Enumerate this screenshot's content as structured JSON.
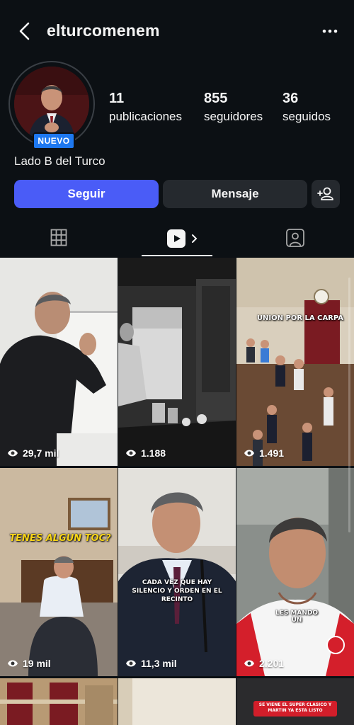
{
  "profile": {
    "username": "elturcomenem",
    "badge": "NUEVO",
    "display_name": "Lado B del Turco",
    "stats": {
      "posts": {
        "value": "11",
        "label": "publicaciones"
      },
      "followers": {
        "value": "855",
        "label": "seguidores"
      },
      "following": {
        "value": "36",
        "label": "seguidos"
      }
    }
  },
  "actions": {
    "follow_label": "Seguir",
    "message_label": "Mensaje"
  },
  "tabs": [
    {
      "name": "grid",
      "icon": "grid-icon"
    },
    {
      "name": "reels",
      "icon": "reels-icon",
      "active": true
    },
    {
      "name": "tagged",
      "icon": "tagged-icon"
    }
  ],
  "reels": [
    {
      "views": "29,7 mil",
      "caption": ""
    },
    {
      "views": "1.188",
      "caption": ""
    },
    {
      "views": "1.491",
      "caption": "UNION POR LA CARPA"
    },
    {
      "views": "19 mil",
      "caption": "TENES ALGUN TOC?"
    },
    {
      "views": "11,3 mil",
      "caption": "CADA VEZ QUE HAY SILENCIO Y ORDEN EN EL RECINTO"
    },
    {
      "views": "2.201",
      "caption": "LES MANDO UN"
    },
    {
      "views": "",
      "caption": ""
    },
    {
      "views": "",
      "caption": ""
    },
    {
      "views": "",
      "caption": "SE VIENE EL SUPER CLASICO Y MARTIN YA ESTA LISTO"
    }
  ],
  "colors": {
    "background": "#0c1014",
    "follow_button": "#4a5cf7",
    "secondary_button": "#25292e",
    "new_badge": "#1e78f0"
  }
}
